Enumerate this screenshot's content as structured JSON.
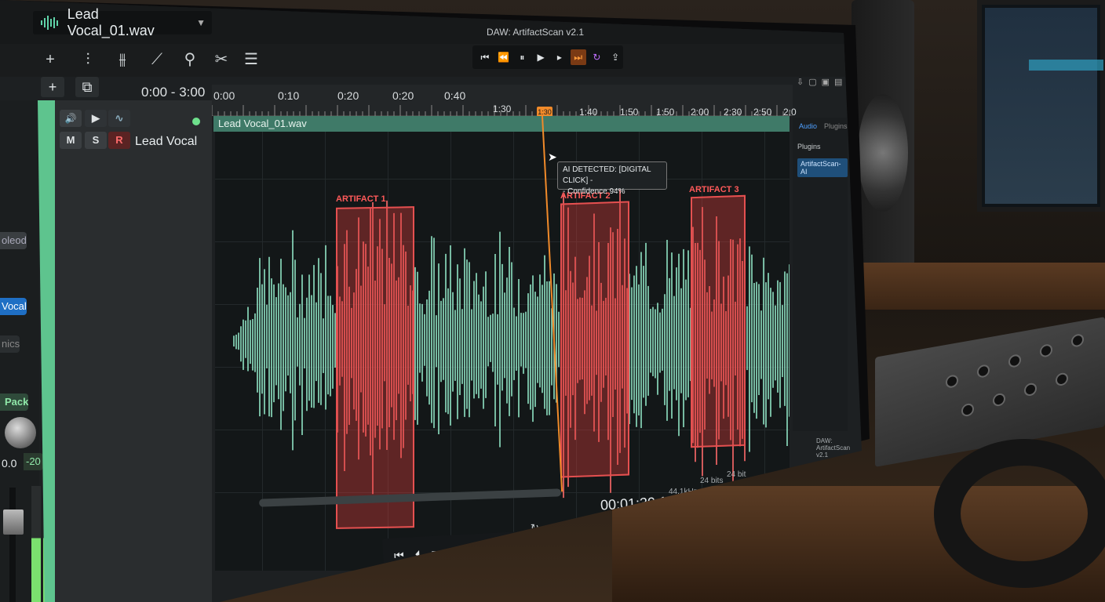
{
  "app": {
    "title": "DAW: ArtifactScan v2.1"
  },
  "track_selector": {
    "name": "Lead Vocal_01.wav"
  },
  "toolbar": {
    "icons": [
      "plus-icon",
      "mixer-sliders-icon",
      "eq-sliders-icon",
      "pencil-icon",
      "wand-icon",
      "scissors-icon",
      "list-icon"
    ]
  },
  "top_transport": {
    "icons": [
      "skip-back-icon",
      "rewind-icon",
      "pause-icon",
      "play-icon",
      "play-small-icon",
      "skip-forward-icon",
      "loop-icon",
      "export-icon"
    ]
  },
  "range": {
    "label": "0:00 - 3:00"
  },
  "ruler": {
    "labels": [
      "0:00",
      "0:10",
      "0:20",
      "0:20",
      "0:40",
      "1:30",
      "1:40",
      "1:50",
      "1:50",
      "2:00",
      "2:30",
      "2:50",
      "2:0"
    ],
    "playhead_flag": "1:30"
  },
  "track": {
    "name": "Lead Vocal",
    "mute": "M",
    "solo": "S",
    "record": "R",
    "clip_name": "Lead Vocal_01.wav"
  },
  "left_dock": {
    "items": [
      "oleod",
      "Vocal",
      "nics",
      "Pack"
    ],
    "value_left": "0.0",
    "value_right": "-20"
  },
  "artifacts": [
    {
      "label": "ARTIFACT 1"
    },
    {
      "label": "ARTIFACT 2"
    },
    {
      "label": "ARTIFACT 3"
    }
  ],
  "tooltip": {
    "line1": "AI DETECTED: [DIGITAL CLICK] -",
    "line2": "- Confidence 94%"
  },
  "side_panel": {
    "tab_active": "Audio",
    "tab_other": "Plugins",
    "header": "Plugins",
    "item": "ArtifactScan-AI"
  },
  "status": {
    "time": "00:01:30:15",
    "sample_rate": "44.1kHz",
    "bit_depth_1": "24 bits",
    "bit_depth_2": "24 bit",
    "footer": "DAW: ArtifactScan v2.1"
  },
  "colors": {
    "waveform": "#8fe3c4",
    "artifact": "#e55050",
    "playhead": "#f08a2a",
    "accent": "#5ec48e"
  }
}
